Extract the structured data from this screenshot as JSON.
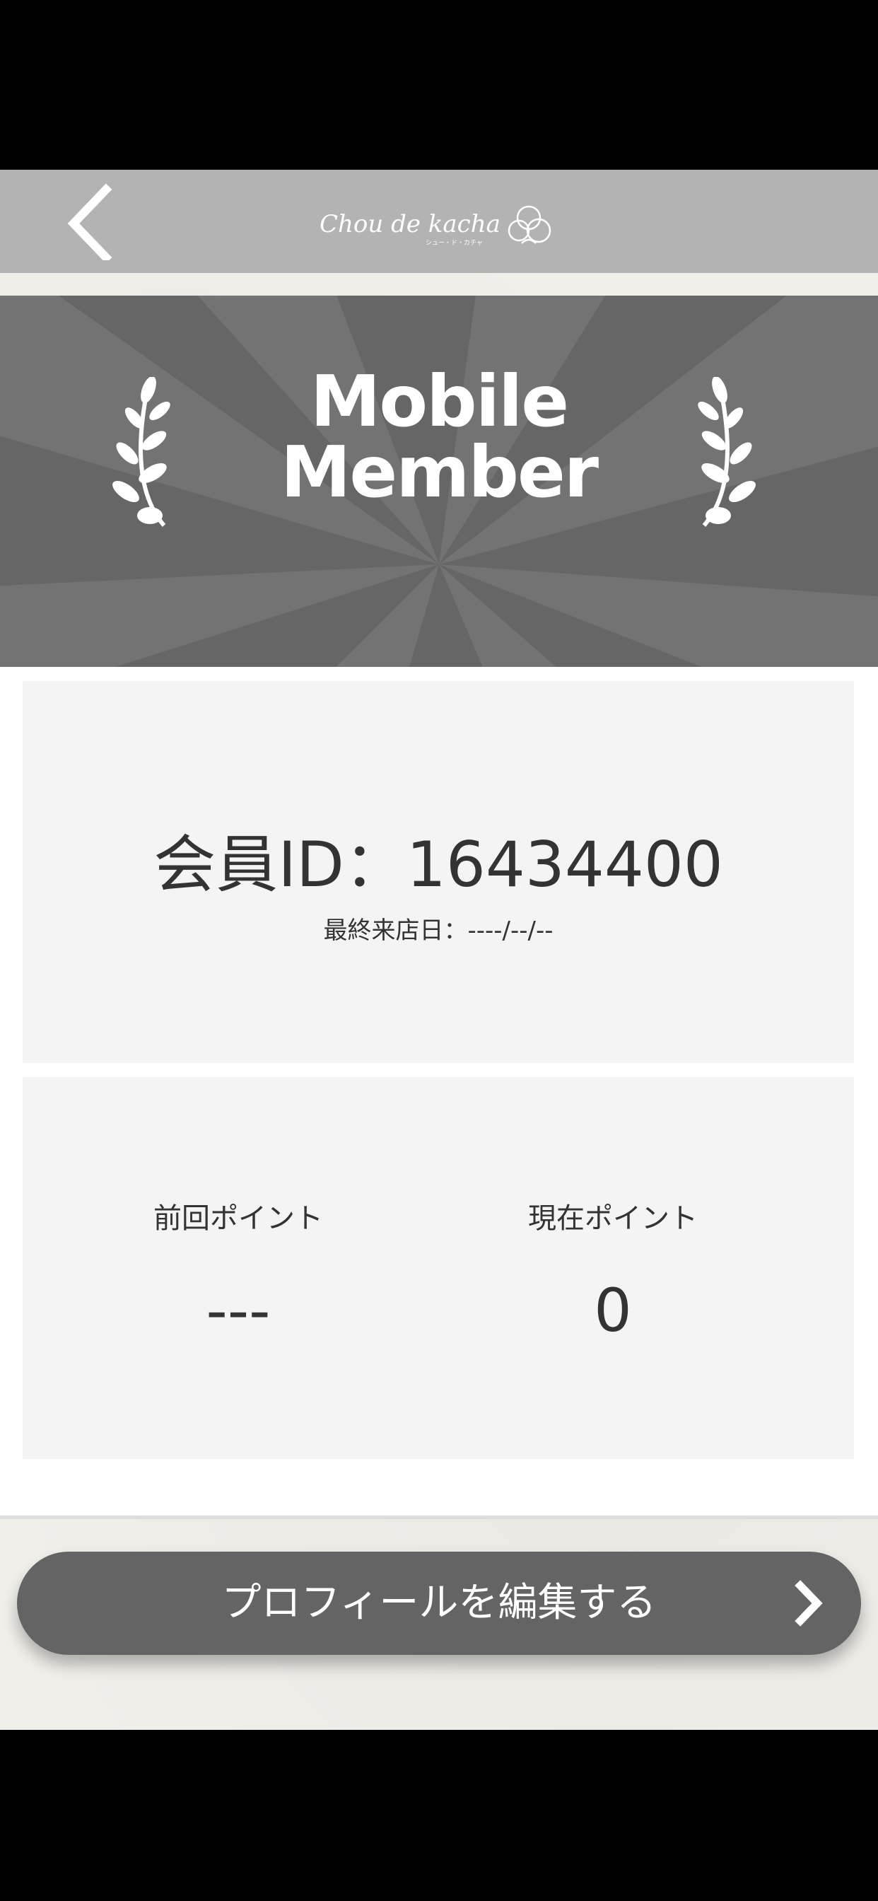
{
  "header": {
    "back_icon": "chevron-left-icon",
    "logo_text": "Chou de kacha",
    "logo_subtext": "シュー・ド・カチャ"
  },
  "banner": {
    "title_line1": "Mobile",
    "title_line2": "Member",
    "decoration_icon": "laurel-branch-icon"
  },
  "member_card": {
    "member_id": "会員ID：16434400",
    "last_visit": "最終来店日：----/--/--"
  },
  "points_card": {
    "previous_label": "前回ポイント",
    "previous_value": "---",
    "current_label": "現在ポイント",
    "current_value": "0"
  },
  "edit_profile": {
    "label": "プロフィールを編集する",
    "icon": "chevron-right-icon"
  },
  "colors": {
    "header_bg": "#b3b3b3",
    "banner_bg": "#666666",
    "button_bg": "#646464",
    "card_bg": "#f4f4f4"
  }
}
